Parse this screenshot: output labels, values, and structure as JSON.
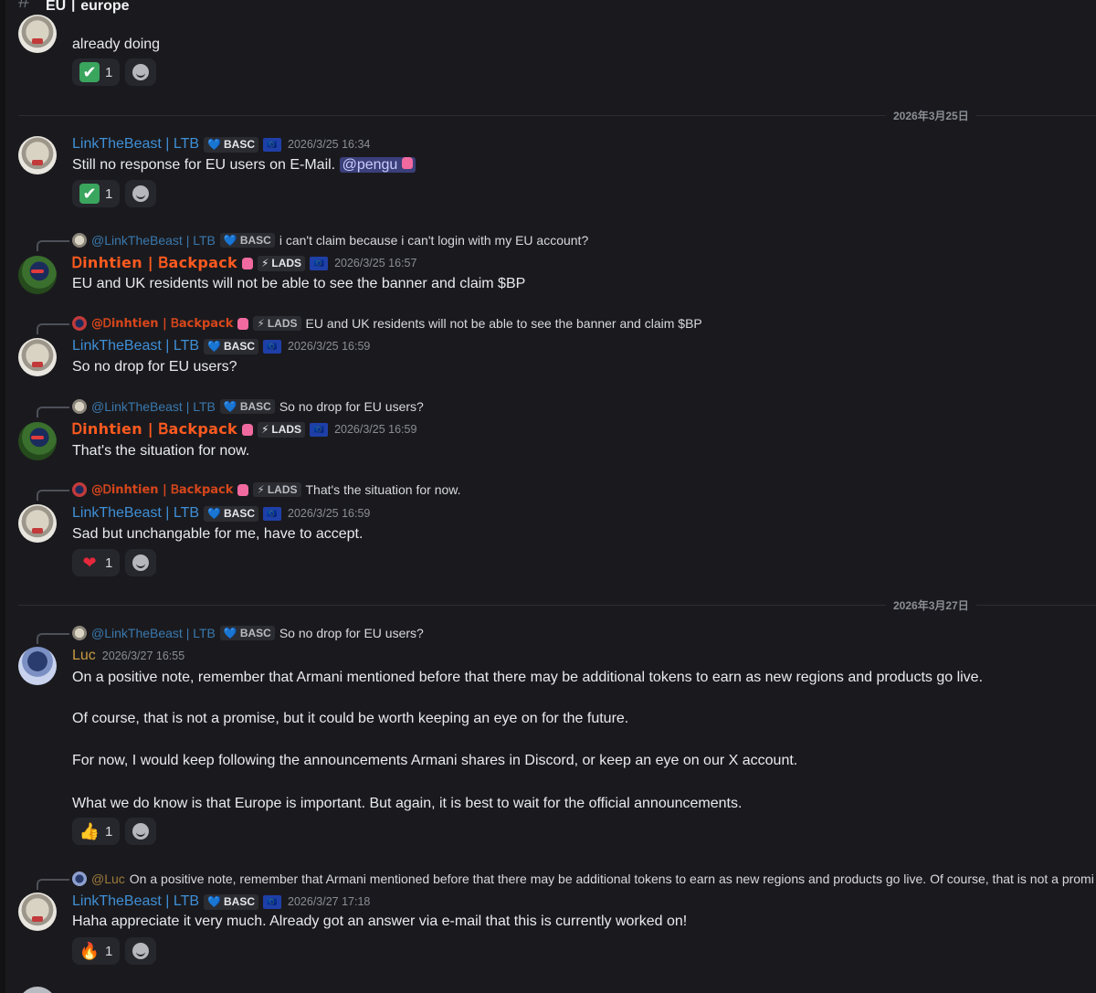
{
  "channel": {
    "name": "EU丨europe"
  },
  "users": {
    "ltb": {
      "name": "LinkTheBeast | LTB",
      "tag": "BASC",
      "tag_icon": "💙",
      "flag": "🇪🇺"
    },
    "din": {
      "name": "Ꭰinhtien | Ᏼackpack",
      "tag": "LADS",
      "tag_icon": "⚡",
      "flag": "🇪🇺"
    },
    "luc": {
      "name": "Luc"
    }
  },
  "dividers": [
    "2026年3月25日",
    "2026年3月27日"
  ],
  "messages": [
    {
      "text": "already doing",
      "reaction": {
        "emoji": "✔",
        "count": "1"
      }
    },
    {
      "timestamp": "2026/3/25 16:34",
      "text": "Still no response for EU users on E-Mail.",
      "mention": "@pengu",
      "reaction": {
        "emoji": "✔",
        "count": "1"
      }
    },
    {
      "reply_to": "@LinkTheBeast | LTB",
      "reply_text": "i can't claim because i can't login with my EU account?",
      "timestamp": "2026/3/25 16:57",
      "text": "EU and UK residents will not be able to see the banner and claim $BP"
    },
    {
      "reply_to": "@Ꭰinhtien | Ᏼackpack",
      "reply_text": "EU and UK residents will not be able to see the banner and claim $BP",
      "timestamp": "2026/3/25 16:59",
      "text": "So no drop for EU users?"
    },
    {
      "reply_to": "@LinkTheBeast | LTB",
      "reply_text": "So no drop for EU users?",
      "timestamp": "2026/3/25 16:59",
      "text": "That's the situation for now."
    },
    {
      "reply_to": "@Ꭰinhtien | Ᏼackpack",
      "reply_text": "That's the situation for now.",
      "timestamp": "2026/3/25 16:59",
      "text": "Sad but unchangable for me, have to accept.",
      "reaction": {
        "emoji": "❤",
        "count": "1"
      }
    },
    {
      "reply_to": "@LinkTheBeast | LTB",
      "reply_text": "So no drop for EU users?",
      "timestamp": "2026/3/27 16:55",
      "paragraphs": [
        "On a positive note, remember that Armani mentioned before that there may be additional tokens to earn as new regions and products go live.",
        "Of course, that is not a promise, but it could be worth keeping an eye on for the future.",
        "For now, I would keep following the announcements Armani shares in Discord, or keep an eye on our X account.",
        "What we do know is that Europe is important. But again, it is best to wait for the official announcements."
      ],
      "reaction": {
        "emoji": "👍",
        "count": "1"
      }
    },
    {
      "reply_to": "@Luc",
      "reply_text": "On a positive note, remember that Armani mentioned before that there may be additional tokens to earn as new regions and products go live.  Of course, that is not a promi",
      "timestamp": "2026/3/27 17:18",
      "text": "Haha appreciate it very much. Already got an answer via e-mail that this is currently worked on!",
      "reaction": {
        "emoji": "🔥",
        "count": "1"
      }
    }
  ]
}
